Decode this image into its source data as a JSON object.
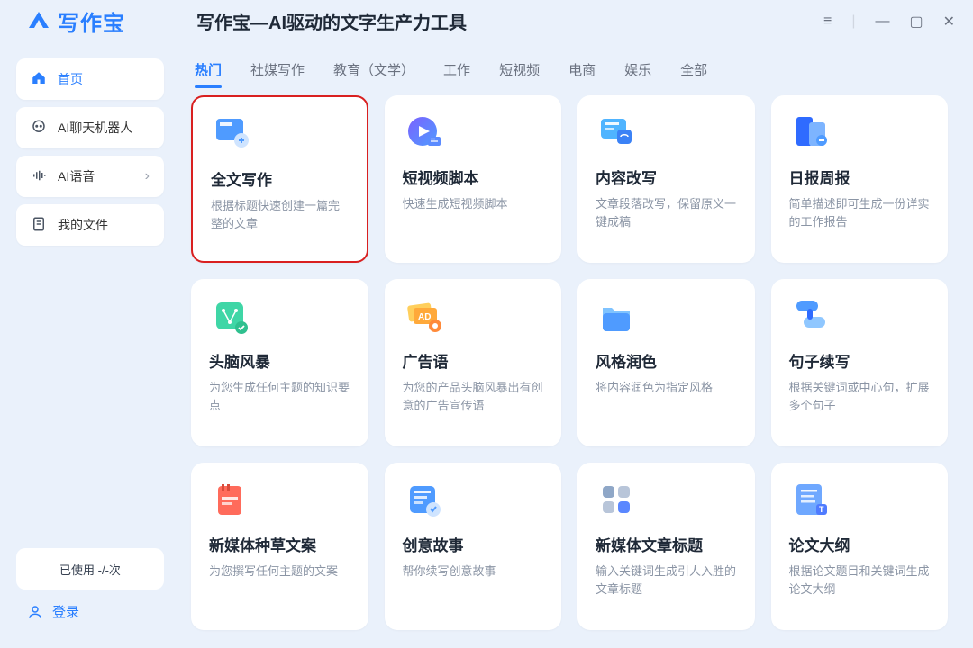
{
  "app": {
    "logo_text": "写作宝",
    "title": "写作宝—AI驱动的文字生产力工具"
  },
  "sidebar": {
    "items": [
      {
        "label": "首页",
        "active": true,
        "icon": "home"
      },
      {
        "label": "AI聊天机器人",
        "icon": "chat"
      },
      {
        "label": "AI语音",
        "icon": "voice",
        "chevron": true
      },
      {
        "label": "我的文件",
        "icon": "file"
      }
    ],
    "usage": "已使用 -/-次",
    "login": "登录"
  },
  "tabs": [
    "热门",
    "社媒写作",
    "教育（文学）",
    "工作",
    "短视频",
    "电商",
    "娱乐",
    "全部"
  ],
  "active_tab": 0,
  "cards": [
    {
      "title": "全文写作",
      "desc": "根据标题快速创建一篇完整的文章",
      "highlight": true,
      "icon": "doc-blue"
    },
    {
      "title": "短视频脚本",
      "desc": "快速生成短视频脚本",
      "icon": "video-purple"
    },
    {
      "title": "内容改写",
      "desc": "文章段落改写，保留原义一键成稿",
      "icon": "rewrite-blue"
    },
    {
      "title": "日报周报",
      "desc": "简单描述即可生成一份详实的工作报告",
      "icon": "report-blue"
    },
    {
      "title": "头脑风暴",
      "desc": "为您生成任何主题的知识要点",
      "icon": "brain-green"
    },
    {
      "title": "广告语",
      "desc": "为您的产品头脑风暴出有创意的广告宣传语",
      "icon": "ad-yellow"
    },
    {
      "title": "风格润色",
      "desc": "将内容润色为指定风格",
      "icon": "folder-blue"
    },
    {
      "title": "句子续写",
      "desc": "根据关键词或中心句，扩展多个句子",
      "icon": "chain-blue"
    },
    {
      "title": "新媒体种草文案",
      "desc": "为您撰写任何主题的文案",
      "icon": "media-red"
    },
    {
      "title": "创意故事",
      "desc": "帮你续写创意故事",
      "icon": "story-blue"
    },
    {
      "title": "新媒体文章标题",
      "desc": "输入关键词生成引人入胜的文章标题",
      "icon": "title-grid"
    },
    {
      "title": "论文大纲",
      "desc": "根据论文题目和关键词生成论文大纲",
      "icon": "outline-blue"
    }
  ]
}
